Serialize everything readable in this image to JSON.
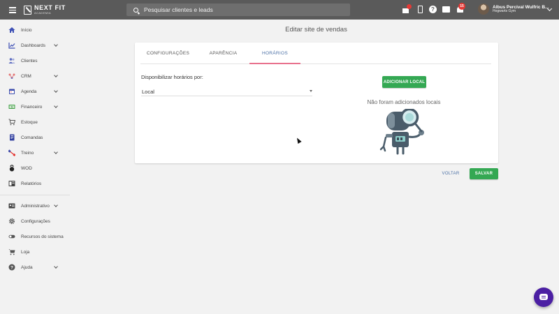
{
  "header": {
    "logo_main": "NEXT FIT",
    "logo_sub": "ACADEMIA",
    "search_placeholder": "Pesquisar clientes e leads",
    "notification_count": "15",
    "user_name": "Albus Percival Wulfric B...",
    "user_org": "Hogwarts Gym",
    "icons": [
      "menu-icon",
      "gift-icon",
      "phone-icon",
      "help-icon",
      "chat-icon",
      "bell-icon",
      "chevron-down-icon"
    ],
    "notification_color": "#e53935"
  },
  "sidebar": {
    "items": [
      {
        "label": "Início",
        "icon": "home-icon",
        "color": "#3f51b5",
        "chevron": false
      },
      {
        "label": "Dashboards",
        "icon": "chart-line-icon",
        "color": "#3f51b5",
        "chevron": true
      },
      {
        "label": "Clientes",
        "icon": "users-icon",
        "color": "#5c6bc0",
        "chevron": false
      },
      {
        "label": "CRM",
        "icon": "crm-icon",
        "color": "#e57373",
        "chevron": true
      },
      {
        "label": "Agenda",
        "icon": "calendar-icon",
        "color": "#3949ab",
        "chevron": true
      },
      {
        "label": "Financeiro",
        "icon": "money-icon",
        "color": "#43a047",
        "chevron": true
      },
      {
        "label": "Estoque",
        "icon": "cart-icon",
        "color": "#555555",
        "chevron": false
      },
      {
        "label": "Comandas",
        "icon": "receipt-icon",
        "color": "#303f9f",
        "chevron": false
      },
      {
        "label": "Treino",
        "icon": "dumbbell-icon",
        "color": "#e53935",
        "chevron": true
      },
      {
        "label": "WOD",
        "icon": "kettlebell-icon",
        "color": "#222222",
        "chevron": false
      },
      {
        "label": "Relatórios",
        "icon": "report-icon",
        "color": "#444444",
        "chevron": false
      },
      {
        "label": "Administrativo",
        "icon": "id-card-icon",
        "color": "#444444",
        "chevron": true
      },
      {
        "label": "Configurações",
        "icon": "gear-icon",
        "color": "#555555",
        "chevron": false
      },
      {
        "label": "Recursos do sistema",
        "icon": "toggle-icon",
        "color": "#555555",
        "chevron": false
      },
      {
        "label": "Loja",
        "icon": "shop-cart-icon",
        "color": "#555555",
        "chevron": false
      },
      {
        "label": "Ajuda",
        "icon": "help-circle-icon",
        "color": "#555555",
        "chevron": true
      }
    ]
  },
  "main": {
    "title": "Editar site de vendas",
    "tabs": [
      {
        "label": "CONFIGURAÇÕES",
        "active": false
      },
      {
        "label": "APARÊNCIA",
        "active": false
      },
      {
        "label": "HORÁRIOS",
        "active": true
      }
    ],
    "field_label": "Disponibilizar horários por:",
    "select_value": "Local",
    "add_button": "ADICIONAR LOCAL",
    "empty_message": "Não foram adicionados locais",
    "back_button": "VOLTAR",
    "save_button": "SALVAR",
    "accent_green": "#34a853",
    "accent_pink": "#e8718d"
  },
  "chat_widget": {
    "icon": "chat-bubble-icon",
    "color": "#4b1fa3"
  }
}
